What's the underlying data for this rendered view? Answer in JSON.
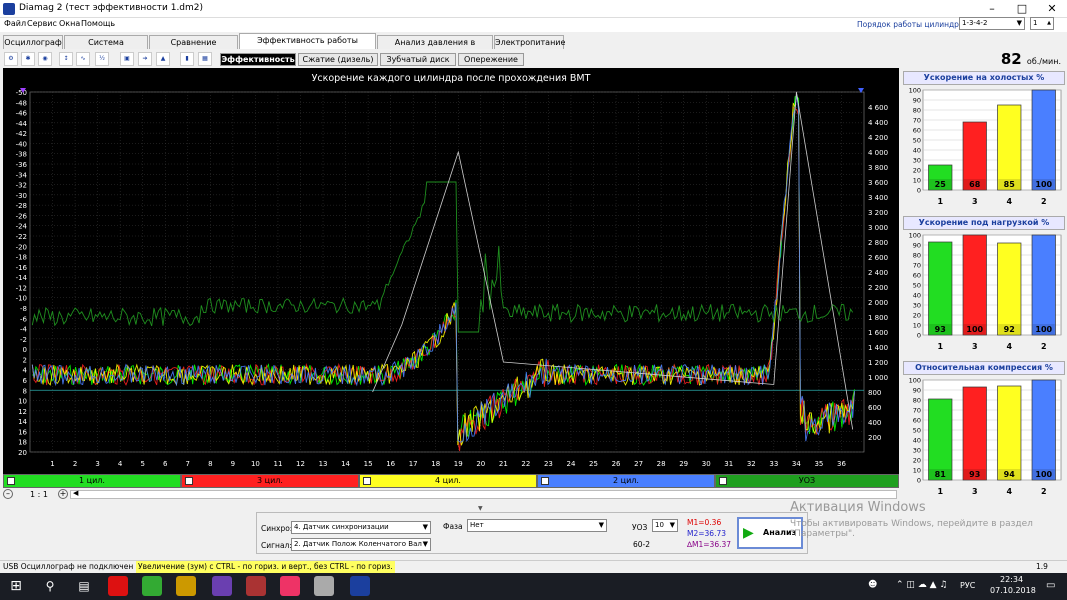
{
  "window": {
    "title": "Diamag 2 (тест эффективности 1.dm2)"
  },
  "menu": [
    "Файл",
    "Сервис",
    "Окна",
    "Помощь"
  ],
  "cyl_order": {
    "label": "Порядок работы цилиндров",
    "value": "1-3-4-2",
    "spin": "1"
  },
  "tabs": [
    "Осциллограф",
    "Система зажигания",
    "Сравнение цилиндров",
    "Эффективность работы цилиндров",
    "Анализ давления в цилиндре",
    "Электропитание"
  ],
  "active_tab": 3,
  "toolbar_icons": [
    "channels-icon",
    "ignition-icon",
    "sensor-icon",
    "scale-icon",
    "wave-icon",
    "half-icon",
    "filter-icon",
    "cursor-icon",
    "marker-icon",
    "bars-icon",
    "settings-icon"
  ],
  "subtabs": [
    "Эффективность",
    "Сжатие (дизель)",
    "Зубчатый диск",
    "Опережение"
  ],
  "rpm": {
    "value": "82",
    "unit": "об./мин."
  },
  "chart_title": "Ускорение каждого цилиндра после прохождения ВМТ",
  "chart_data": {
    "type": "line",
    "title": "Ускорение каждого цилиндра после прохождения ВМТ",
    "left_axis_ticks": [
      "-50",
      "-48",
      "-46",
      "-44",
      "-42",
      "-40",
      "-38",
      "-36",
      "-34",
      "-32",
      "-30",
      "-28",
      "-26",
      "-24",
      "-22",
      "-20",
      "-18",
      "-16",
      "-14",
      "-12",
      "-10",
      "-8",
      "-6",
      "-4",
      "-2",
      "0",
      "2",
      "4",
      "6",
      "8",
      "10",
      "12",
      "14",
      "16",
      "18",
      "20"
    ],
    "left_ylim": [
      -50,
      20
    ],
    "right_axis_ticks": [
      "4 600",
      "4 400",
      "4 200",
      "4 000",
      "3 800",
      "3 600",
      "3 400",
      "3 200",
      "3 000",
      "2 800",
      "2 600",
      "2 400",
      "2 200",
      "2 000",
      "1 800",
      "1 600",
      "1 400",
      "1 200",
      "1 000",
      "800",
      "600",
      "400",
      "200"
    ],
    "right_ylim": [
      0,
      4800
    ],
    "x_ticks": [
      "1",
      "2",
      "3",
      "4",
      "5",
      "6",
      "7",
      "8",
      "9",
      "10",
      "11",
      "12",
      "13",
      "14",
      "15",
      "16",
      "17",
      "18",
      "19",
      "20",
      "21",
      "22",
      "23",
      "24",
      "25",
      "26",
      "27",
      "28",
      "29",
      "30",
      "31",
      "32",
      "33",
      "34",
      "35",
      "36"
    ],
    "xlim": [
      0,
      37
    ],
    "series": [
      {
        "name": "1 цил.",
        "color": "#00ff00",
        "role": "cyl"
      },
      {
        "name": "3 цил.",
        "color": "#ff2020",
        "role": "cyl"
      },
      {
        "name": "4 цил.",
        "color": "#ffff00",
        "role": "cyl"
      },
      {
        "name": "2 цил.",
        "color": "#4a7fff",
        "role": "cyl"
      },
      {
        "name": "УОЗ",
        "color": "#1f8f1f",
        "role": "uoz"
      }
    ]
  },
  "cylinders": [
    {
      "label": "1 цил.",
      "color": "#22dd22"
    },
    {
      "label": "3 цил.",
      "color": "#ff2020"
    },
    {
      "label": "4 цил.",
      "color": "#ffff20"
    },
    {
      "label": "2 цил.",
      "color": "#4a7fff"
    },
    {
      "label": "УОЗ",
      "color": "#1f9f1f"
    }
  ],
  "zoom": {
    "label": "1 : 1"
  },
  "panels": [
    {
      "title": "Ускорение на холостых %",
      "values": [
        25,
        68,
        85,
        100
      ],
      "cyls": [
        "1",
        "3",
        "4",
        "2"
      ]
    },
    {
      "title": "Ускорение под нагрузкой %",
      "values": [
        93,
        100,
        92,
        100
      ],
      "cyls": [
        "1",
        "3",
        "4",
        "2"
      ]
    },
    {
      "title": "Относительная компрессия %",
      "values": [
        81,
        93,
        94,
        100
      ],
      "cyls": [
        "1",
        "3",
        "4",
        "2"
      ]
    }
  ],
  "panel_ticks": [
    "100",
    "90",
    "80",
    "70",
    "60",
    "50",
    "40",
    "30",
    "20",
    "10",
    "0"
  ],
  "bar_colors": [
    "#22dd22",
    "#ff2020",
    "#ffff20",
    "#4a7fff"
  ],
  "bottom": {
    "sync_label": "Синхро:",
    "sync_value": "4. Датчик синхронизации",
    "signal_label": "Сигнал:",
    "signal_value": "2. Датчик Полож Коленчатого Вал",
    "phase_label": "Фаза",
    "phase_value": "Нет",
    "uoz_label": "УОЗ",
    "uoz_value": "10",
    "disk": "60-2",
    "m1": "M1=0.36",
    "m2": "M2=36.73",
    "dm": "∆M1=36.37",
    "analyze": "Анализ"
  },
  "watermark": {
    "title": "Активация Windows",
    "text": "Чтобы активировать Windows, перейдите в раздел \"Параметры\"."
  },
  "status": {
    "usb": "USB Осциллограф не подключен",
    "hint": "Увеличение (зум) с CTRL - по гориз. и верт., без CTRL - по гориз.",
    "ver": "1.9"
  },
  "taskbar": {
    "lang": "РУС",
    "time": "22:34",
    "date": "07.10.2018"
  }
}
